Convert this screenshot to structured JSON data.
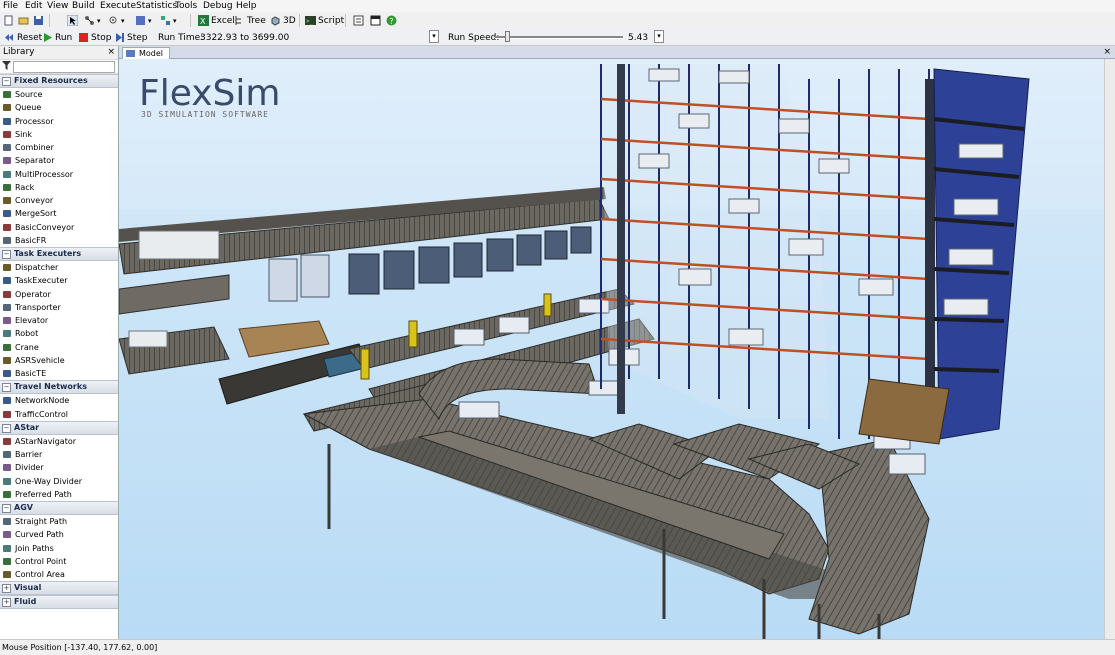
{
  "menu": [
    "File",
    "Edit",
    "View",
    "Build",
    "Execute",
    "Statistics",
    "Tools",
    "Debug",
    "Help"
  ],
  "toolbar": {
    "excel": "Excel",
    "tree": "Tree",
    "view3d": "3D",
    "script": "Script"
  },
  "runbar": {
    "reset": "Reset",
    "run": "Run",
    "stop": "Stop",
    "step": "Step",
    "run_time_label": "Run Time:",
    "run_time_value": "3322.93  to  3699.00",
    "run_speed_label": "Run Speed:",
    "run_speed_value": "5.43",
    "speed_slider_fraction": 0.09
  },
  "library": {
    "title": "Library",
    "close": "×",
    "categories": [
      {
        "label": "Fixed Resources",
        "expanded": true,
        "items": [
          "Source",
          "Queue",
          "Processor",
          "Sink",
          "Combiner",
          "Separator",
          "MultiProcessor",
          "Rack",
          "Conveyor",
          "MergeSort",
          "BasicConveyor",
          "BasicFR"
        ]
      },
      {
        "label": "Task Executers",
        "expanded": true,
        "items": [
          "Dispatcher",
          "TaskExecuter",
          "Operator",
          "Transporter",
          "Elevator",
          "Robot",
          "Crane",
          "ASRSvehicle",
          "BasicTE"
        ]
      },
      {
        "label": "Travel Networks",
        "expanded": true,
        "items": [
          "NetworkNode",
          "TrafficControl"
        ]
      },
      {
        "label": "AStar",
        "expanded": true,
        "items": [
          "AStarNavigator",
          "Barrier",
          "Divider",
          "One-Way Divider",
          "Preferred Path"
        ]
      },
      {
        "label": "AGV",
        "expanded": true,
        "items": [
          "Straight Path",
          "Curved Path",
          "Join Paths",
          "Control Point",
          "Control Area"
        ]
      },
      {
        "label": "Visual",
        "expanded": false,
        "items": []
      },
      {
        "label": "Fluid",
        "expanded": false,
        "items": []
      }
    ]
  },
  "model_tab": {
    "label": "Model",
    "close": "×"
  },
  "logo": {
    "title": "FlexSim",
    "subtitle": "3D SIMULATION SOFTWARE"
  },
  "status": "Mouse Position [-137.40, 177.62, 0.00]",
  "colors": {
    "sky": "#c5e2f7",
    "rack_blue": "#2a3f8f",
    "rack_beam": "#c2522a",
    "conveyor": "#6e6a63",
    "operator": "#d7c21c"
  }
}
